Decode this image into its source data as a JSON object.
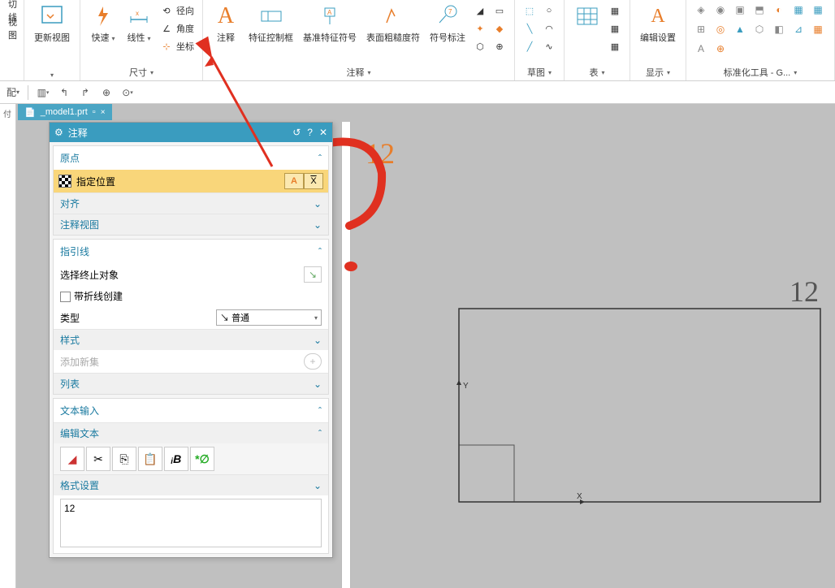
{
  "ribbon": {
    "group_view": {
      "btn1": "切线",
      "btn2": "视图",
      "big_update": "更新视图"
    },
    "group_dimension": {
      "label": "尺寸",
      "big_fast": "快速",
      "big_linear": "线性",
      "small_radial": "径向",
      "small_angle": "角度",
      "small_coord": "坐标"
    },
    "group_annotation": {
      "label": "注释",
      "big_note": "注释",
      "big_fcf": "特征控制框",
      "big_datum": "基准特征符号",
      "big_surface": "表面粗糙度符",
      "big_balloon": "符号标注"
    },
    "group_sketch": {
      "label": "草图"
    },
    "group_table": {
      "label": "表"
    },
    "group_edit": {
      "big": "编辑设置",
      "label": "显示"
    },
    "group_std": {
      "label": "标准化工具 - G..."
    }
  },
  "tab": {
    "filename": "_model1.prt",
    "close": "×"
  },
  "dialog": {
    "title": "注释",
    "sec_origin": "原点",
    "row_specify": "指定位置",
    "row_align": "对齐",
    "row_anno_view": "注释视图",
    "sec_leader": "指引线",
    "row_select_end": "选择终止对象",
    "row_polyline": "带折线创建",
    "row_type_label": "类型",
    "row_type_value": "普通",
    "row_style": "样式",
    "row_addset": "添加新集",
    "row_list": "列表",
    "sec_textinput": "文本输入",
    "row_edittext": "编辑文本",
    "row_format": "格式设置",
    "textarea_value": "12"
  },
  "canvas": {
    "text_orange": "12",
    "text_gray": "12",
    "axis_x": "X",
    "axis_y": "Y"
  }
}
